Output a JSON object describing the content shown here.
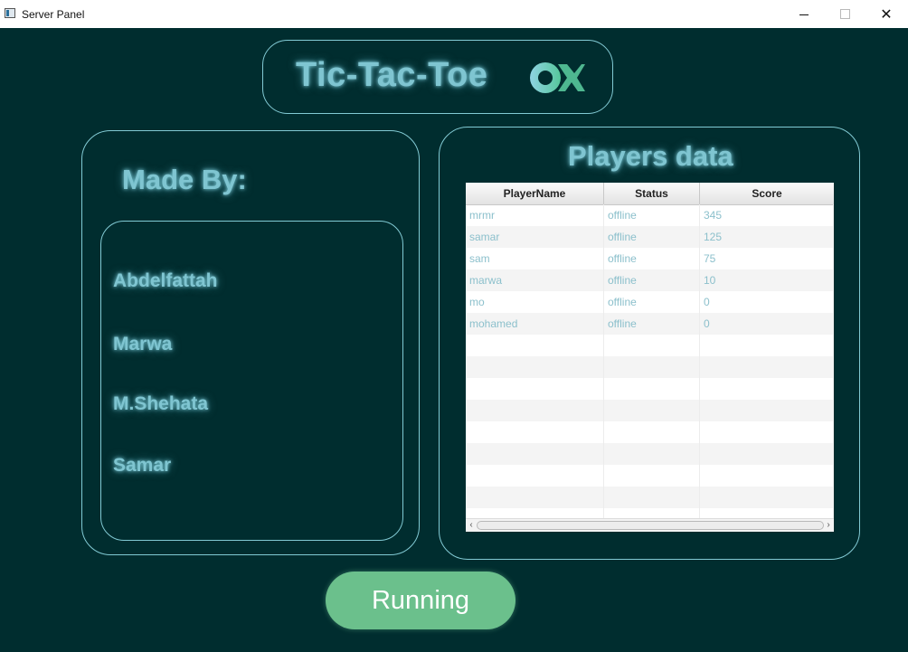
{
  "window": {
    "title": "Server Panel",
    "minimize": "—",
    "maximize": "□",
    "close": "✕"
  },
  "header": {
    "title": "Tic-Tac-Toe",
    "logo_icon": "ox-logo-icon"
  },
  "made_by": {
    "title": "Made By:",
    "members": [
      "Abdelfattah",
      "Marwa",
      "M.Shehata",
      "Samar"
    ]
  },
  "players": {
    "title": "Players data",
    "columns": [
      "PlayerName",
      "Status",
      "Score"
    ],
    "rows": [
      [
        "mrmr",
        "offline",
        "345"
      ],
      [
        "samar",
        "offline",
        "125"
      ],
      [
        "sam",
        "offline",
        "75"
      ],
      [
        "marwa",
        "offline",
        "10"
      ],
      [
        "mo",
        "offline",
        "0"
      ],
      [
        "mohamed",
        "offline",
        "0"
      ]
    ],
    "scroll_left": "‹",
    "scroll_right": "›"
  },
  "status_button": {
    "label": "Running"
  },
  "colors": {
    "background": "#002d2f",
    "accent_border": "#82cad4",
    "glow_text": "#7fc5d1",
    "button": "#6bc08c"
  }
}
